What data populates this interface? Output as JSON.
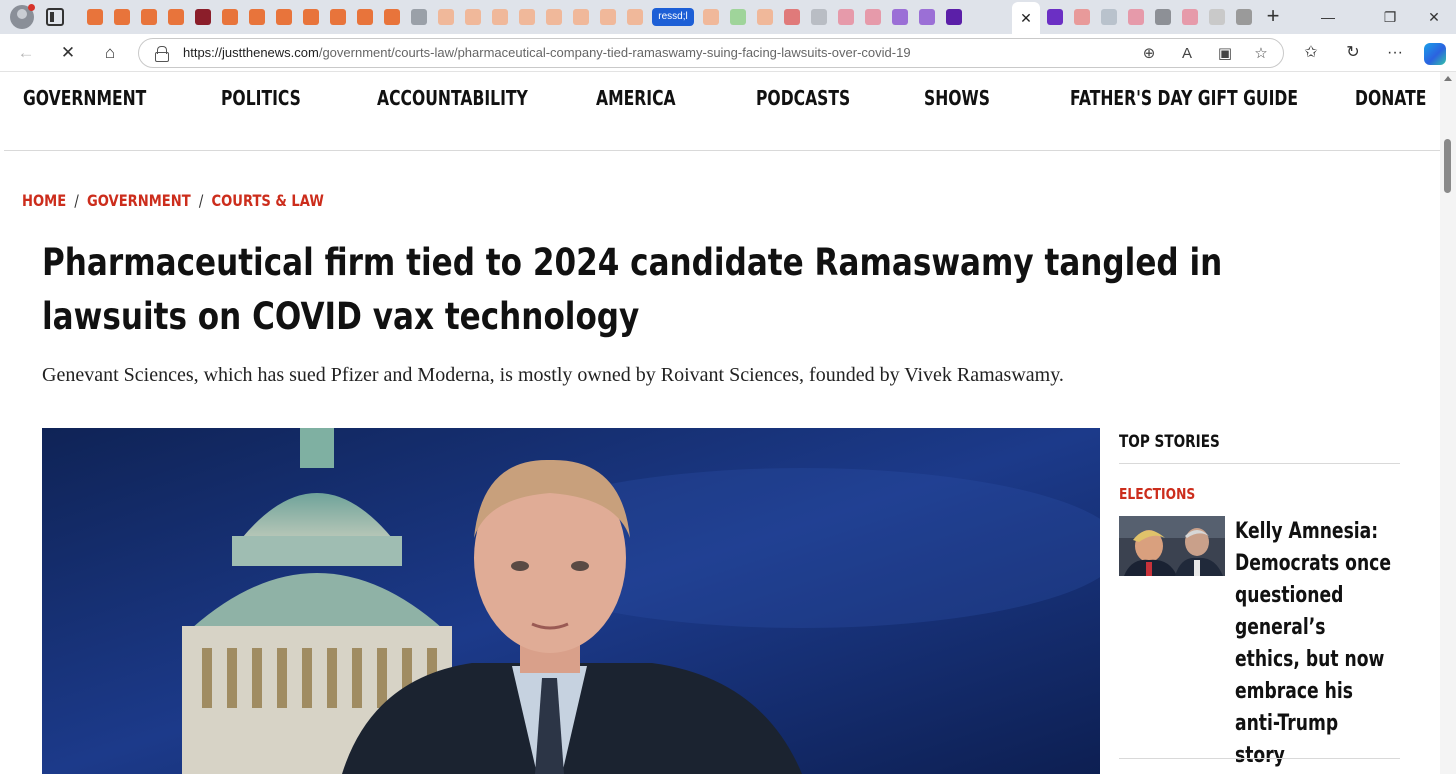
{
  "browser": {
    "tab_badge_text": "ressd;l",
    "active_tab_close": "✕",
    "new_tab": "+",
    "window_controls": {
      "minimize": "—",
      "restore": "❐",
      "close": "✕"
    },
    "url_host": "https://justthenews.com",
    "url_path": "/government/courts-law/pharmaceutical-company-tied-ramaswamy-suing-facing-lawsuits-over-covid-19",
    "icons": {
      "back": "back-arrow-icon",
      "stop": "stop-loading-icon",
      "home": "home-icon",
      "zoom": "zoom-icon",
      "read_aloud": "read-aloud-icon",
      "immersive": "immersive-reader-icon",
      "favorite": "favorite-star-icon",
      "favorites": "favorites-icon",
      "history": "history-icon",
      "more": "more-icon",
      "copilot": "copilot-icon"
    },
    "glyphs": {
      "back": "←",
      "stop": "✕",
      "home": "⌂",
      "zoom": "⊕",
      "read_aloud": "A",
      "immersive": "▣",
      "favorite": "☆",
      "favorites": "✩",
      "history": "↻",
      "more": "···"
    }
  },
  "site_nav": {
    "items": [
      {
        "label": "GOVERNMENT"
      },
      {
        "label": "POLITICS"
      },
      {
        "label": "ACCOUNTABILITY"
      },
      {
        "label": "AMERICA"
      },
      {
        "label": "PODCASTS"
      },
      {
        "label": "SHOWS"
      },
      {
        "label": "FATHER'S DAY GIFT GUIDE"
      },
      {
        "label": "DONATE"
      }
    ]
  },
  "breadcrumb": {
    "items": [
      "HOME",
      "GOVERNMENT",
      "COURTS & LAW"
    ],
    "separator": "/"
  },
  "article": {
    "headline": "Pharmaceutical firm tied to 2024 candidate Ramaswamy tangled in lawsuits on COVID vax technology",
    "dek": "Genevant Sciences, which has sued Pfizer and Moderna, is mostly owned by Roivant Sciences, founded by Vivek Ramaswamy."
  },
  "sidebar": {
    "heading": "TOP STORIES",
    "stories": [
      {
        "category": "ELECTIONS",
        "title": "Kelly Amnesia: Democrats once questioned general’s ethics, but now embrace his anti-Trump story"
      }
    ]
  },
  "colors": {
    "accent_red": "#cc2d1c",
    "text_dark": "#111111",
    "tab_strip": "#dfe3ea"
  }
}
